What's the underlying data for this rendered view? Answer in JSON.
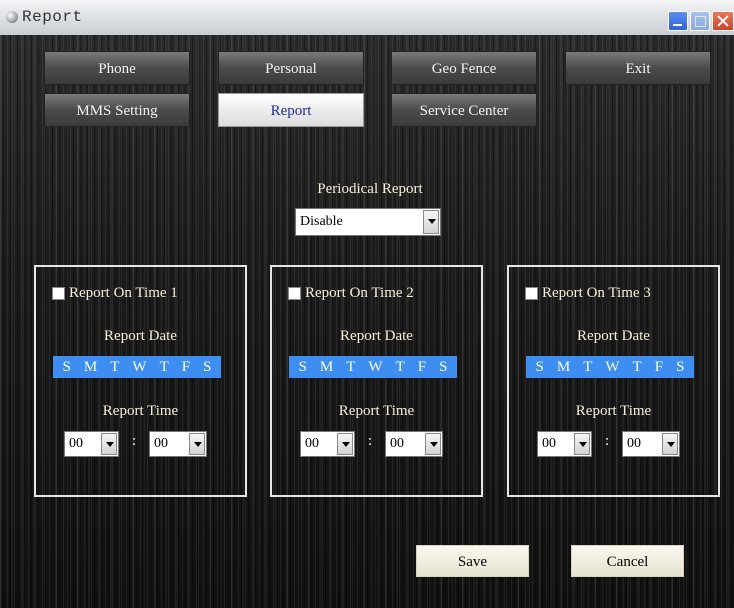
{
  "window": {
    "title": "Report"
  },
  "nav": {
    "phone": "Phone",
    "personal": "Personal",
    "geo_fence": "Geo Fence",
    "exit": "Exit",
    "mms_setting": "MMS Setting",
    "report": "Report",
    "service_center": "Service Center"
  },
  "periodical": {
    "label": "Periodical Report",
    "value": "Disable"
  },
  "groups": [
    {
      "checkbox_label": "Report On Time 1",
      "checked": false,
      "date_label": "Report Date",
      "days": [
        "S",
        "M",
        "T",
        "W",
        "T",
        "F",
        "S"
      ],
      "time_label": "Report Time",
      "hour": "00",
      "minute": "00"
    },
    {
      "checkbox_label": "Report On Time 2",
      "checked": false,
      "date_label": "Report Date",
      "days": [
        "S",
        "M",
        "T",
        "W",
        "T",
        "F",
        "S"
      ],
      "time_label": "Report Time",
      "hour": "00",
      "minute": "00"
    },
    {
      "checkbox_label": "Report On Time 3",
      "checked": false,
      "date_label": "Report Date",
      "days": [
        "S",
        "M",
        "T",
        "W",
        "T",
        "F",
        "S"
      ],
      "time_label": "Report Time",
      "hour": "00",
      "minute": "00"
    }
  ],
  "time_separator": ":",
  "actions": {
    "save": "Save",
    "cancel": "Cancel"
  },
  "colors": {
    "day_strip": "#3d8ef0",
    "active_tab_text": "#1d2aa0",
    "label_text": "#f6f0d8"
  }
}
